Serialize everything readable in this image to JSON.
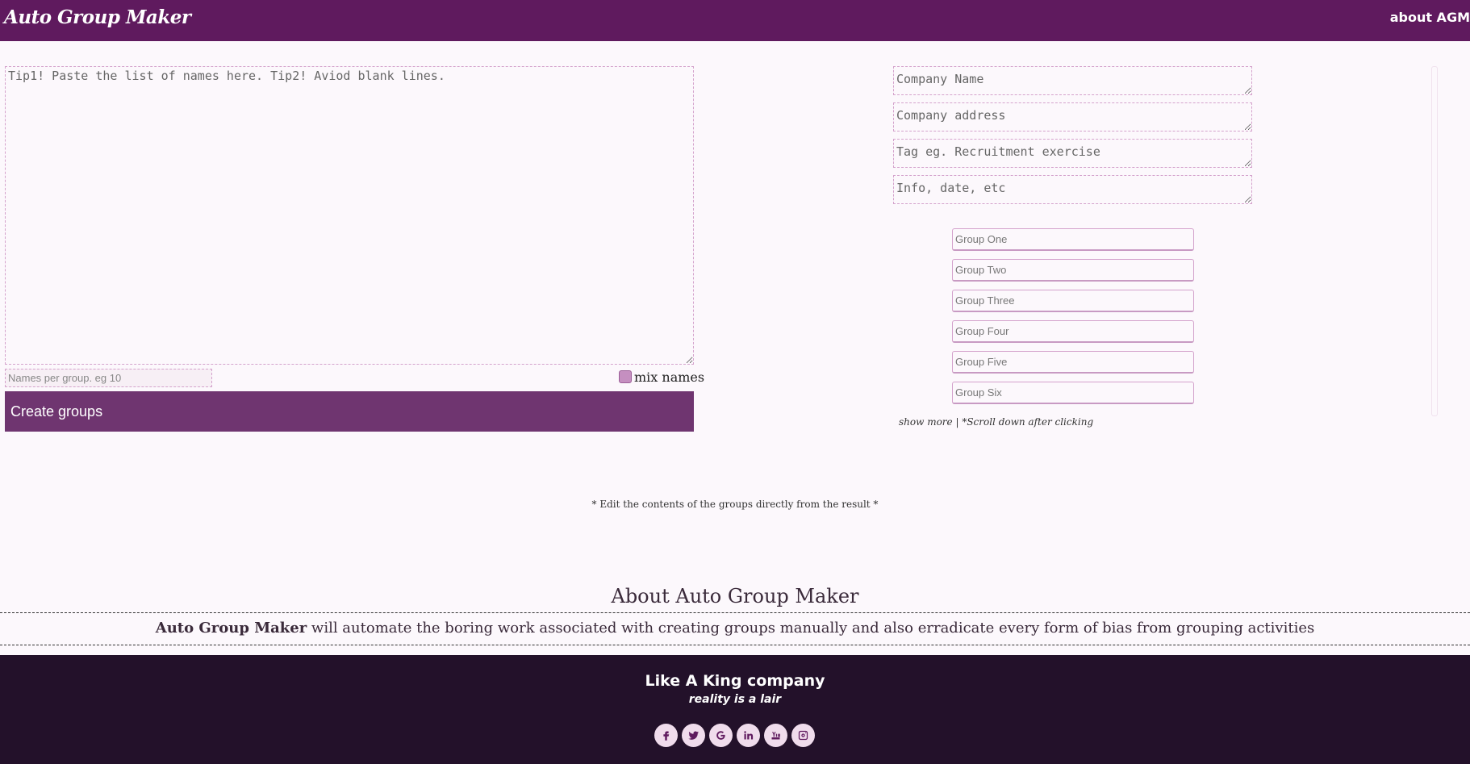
{
  "header": {
    "brand": "Auto Group Maker",
    "about_link": "about AGM"
  },
  "names_form": {
    "names_placeholder": "Tip1! Paste the list of names here. Tip2! Aviod blank lines.",
    "per_group_placeholder": "Names per group. eg 10",
    "mix_label": "mix names",
    "create_button": "Create groups"
  },
  "info_form": {
    "company_name_placeholder": "Company Name",
    "company_address_placeholder": "Company address",
    "tag_placeholder": "Tag eg. Recruitment exercise",
    "info_placeholder": "Info, date, etc"
  },
  "groups": [
    {
      "placeholder": "Group One"
    },
    {
      "placeholder": "Group Two"
    },
    {
      "placeholder": "Group Three"
    },
    {
      "placeholder": "Group Four"
    },
    {
      "placeholder": "Group Five"
    },
    {
      "placeholder": "Group Six"
    }
  ],
  "show_more": {
    "link": "show more",
    "separator": " | ",
    "hint": "*Scroll down after clicking"
  },
  "edit_note": "* Edit the contents of the groups directly from the result *",
  "about": {
    "title": "About Auto Group Maker",
    "brand_bold": "Auto Group Maker",
    "text": " will automate the boring work associated with creating groups manually and also erradicate every form of bias from grouping activities"
  },
  "footer": {
    "company": "Like A King company",
    "slogan": "reality is a lair",
    "socials": [
      "facebook-icon",
      "twitter-icon",
      "google-icon",
      "linkedin-icon",
      "youtube-icon",
      "instagram-icon"
    ]
  },
  "colors": {
    "header_bg": "#5f1a5e",
    "button_bg": "#6f3570",
    "footer_bg": "#23112a",
    "accent_border": "#d4a2cc"
  }
}
